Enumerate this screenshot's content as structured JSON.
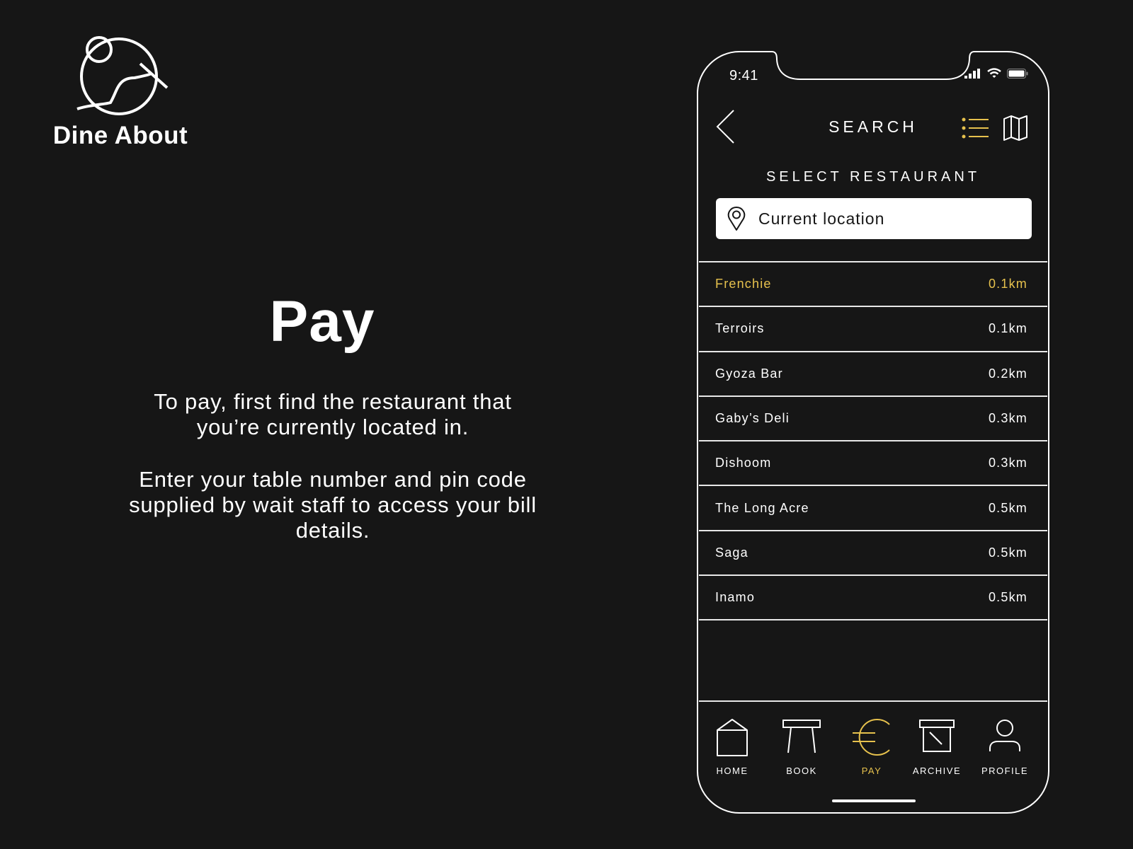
{
  "brand": {
    "name": "Dine About",
    "logo_icon": "chopsticks-globe-logo"
  },
  "intro": {
    "title": "Pay",
    "paragraph1": "To pay, first find the restaurant that you’re currently located in.",
    "paragraph2": "Enter your table number and pin code supplied by wait staff to access your bill details."
  },
  "colors": {
    "background": "#161616",
    "foreground": "#ffffff",
    "accent": "#e6c14d"
  },
  "status_bar": {
    "time": "9:41",
    "icons": [
      "signal-icon",
      "wifi-icon",
      "battery-icon"
    ]
  },
  "nav": {
    "back_icon": "chevron-left-icon",
    "title": "SEARCH",
    "list_view_icon": "list-icon",
    "map_view_icon": "map-icon"
  },
  "section_label": "SELECT RESTAURANT",
  "search": {
    "icon": "location-pin-icon",
    "value": "Current location"
  },
  "restaurants": [
    {
      "name": "Frenchie",
      "distance": "0.1km",
      "selected": true
    },
    {
      "name": "Terroirs",
      "distance": "0.1km",
      "selected": false
    },
    {
      "name": "Gyoza Bar",
      "distance": "0.2km",
      "selected": false
    },
    {
      "name": "Gaby’s Deli",
      "distance": "0.3km",
      "selected": false
    },
    {
      "name": "Dishoom",
      "distance": "0.3km",
      "selected": false
    },
    {
      "name": "The Long Acre",
      "distance": "0.5km",
      "selected": false
    },
    {
      "name": "Saga",
      "distance": "0.5km",
      "selected": false
    },
    {
      "name": "Inamo",
      "distance": "0.5km",
      "selected": false
    }
  ],
  "tabs": [
    {
      "label": "HOME",
      "icon": "house-icon",
      "active": false
    },
    {
      "label": "BOOK",
      "icon": "table-icon",
      "active": false
    },
    {
      "label": "PAY",
      "icon": "euro-icon",
      "active": true
    },
    {
      "label": "ARCHIVE",
      "icon": "archive-box-icon",
      "active": false
    },
    {
      "label": "PROFILE",
      "icon": "person-icon",
      "active": false
    }
  ]
}
